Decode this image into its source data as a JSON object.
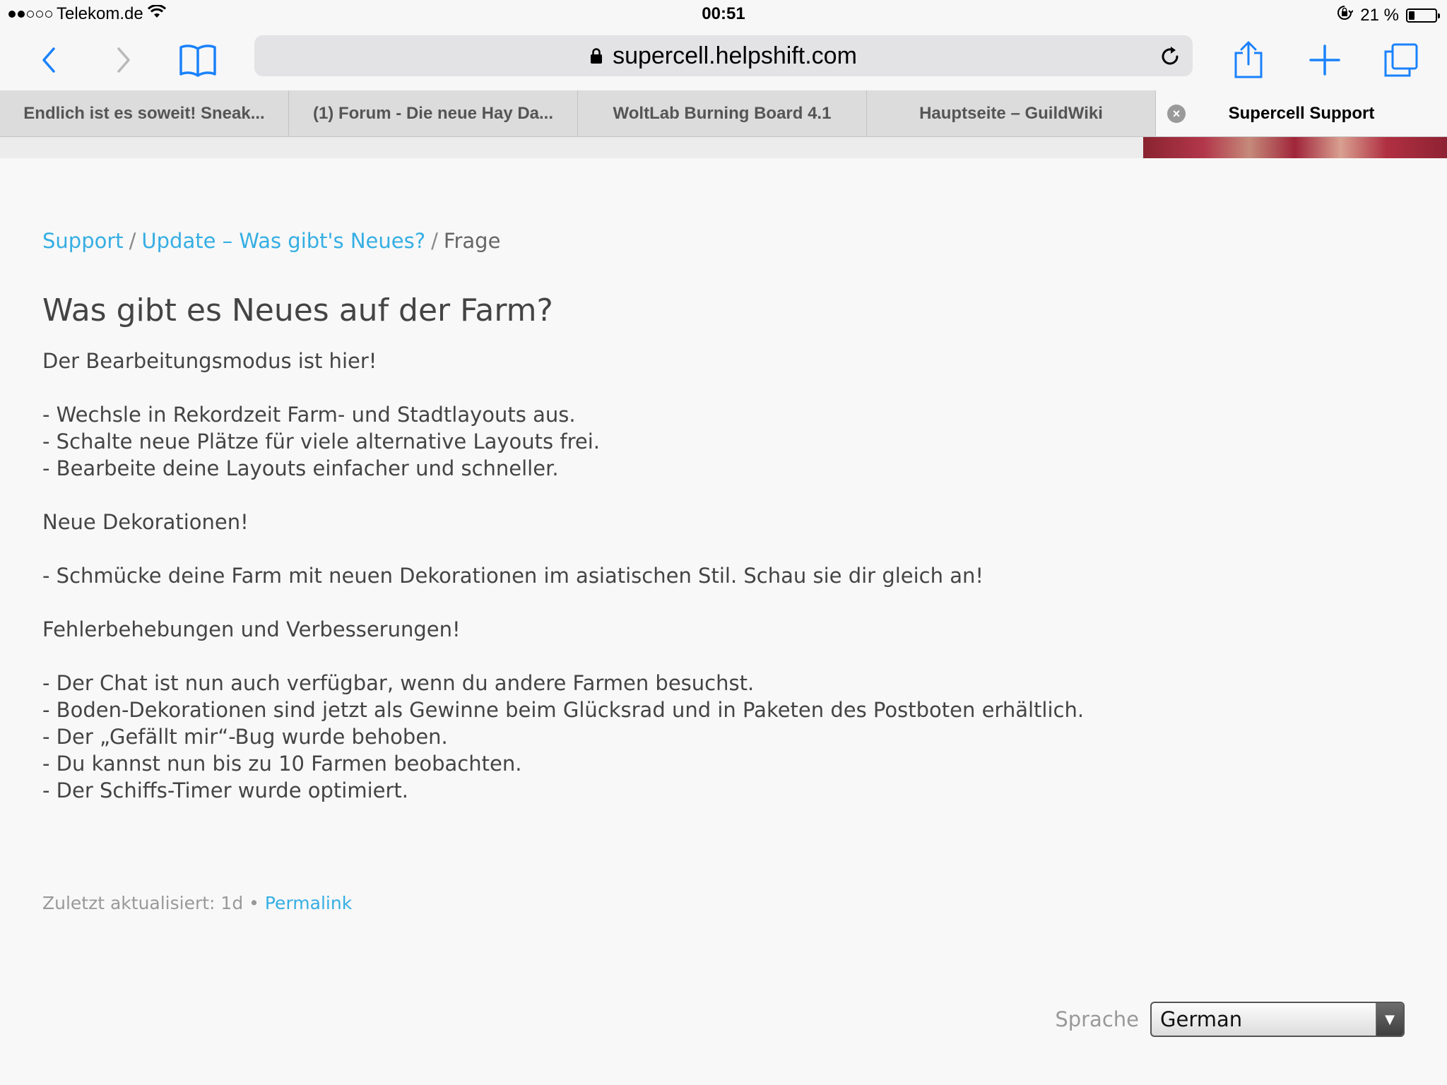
{
  "status_bar": {
    "carrier": "Telekom.de",
    "time": "00:51",
    "battery": "21 %",
    "battery_level": 0.21
  },
  "toolbar": {
    "url": "supercell.helpshift.com",
    "icons": [
      "back-icon",
      "forward-icon",
      "bookmarks-icon",
      "lock-icon",
      "reload-icon",
      "share-icon",
      "new-tab-icon",
      "tabs-icon"
    ]
  },
  "tabs": [
    {
      "label": "Endlich ist es soweit! Sneak..."
    },
    {
      "label": "(1) Forum - Die neue Hay Da..."
    },
    {
      "label": "WoltLab Burning Board 4.1"
    },
    {
      "label": "Hauptseite – GuildWiki"
    },
    {
      "label": "Supercell Support",
      "active": true
    }
  ],
  "breadcrumb": {
    "items": [
      "Support",
      "Update – Was gibt's Neues?"
    ],
    "current": "Frage"
  },
  "article": {
    "title": "Was gibt es Neues auf der Farm?",
    "section1_heading": "Der Bearbeitungsmodus ist hier!",
    "section1_items": [
      "- Wechsle in Rekordzeit Farm- und Stadtlayouts aus.",
      "- Schalte neue Plätze für viele alternative Layouts frei.",
      "- Bearbeite deine Layouts einfacher und schneller."
    ],
    "section2_heading": "Neue Dekorationen!",
    "section2_items": [
      "- Schmücke deine Farm mit neuen Dekorationen im asiatischen Stil. Schau sie dir gleich an!"
    ],
    "section3_heading": "Fehlerbehebungen und Verbesserungen!",
    "section3_items": [
      "- Der Chat ist nun auch verfügbar, wenn du andere Farmen besuchst.",
      "- Boden-Dekorationen sind jetzt als Gewinne beim Glücksrad und in Paketen des Postboten erhältlich.",
      "- Der „Gefällt mir“-Bug wurde behoben.",
      "- Du kannst nun bis zu 10 Farmen beobachten.",
      "- Der Schiffs-Timer wurde optimiert."
    ]
  },
  "meta": {
    "updated": "Zuletzt aktualisiert: 1d",
    "separator": "•",
    "permalink": "Permalink"
  },
  "language": {
    "label": "Sprache",
    "selected": "German"
  },
  "colors": {
    "link": "#35aee3",
    "ios_blue": "#1a82fb"
  }
}
